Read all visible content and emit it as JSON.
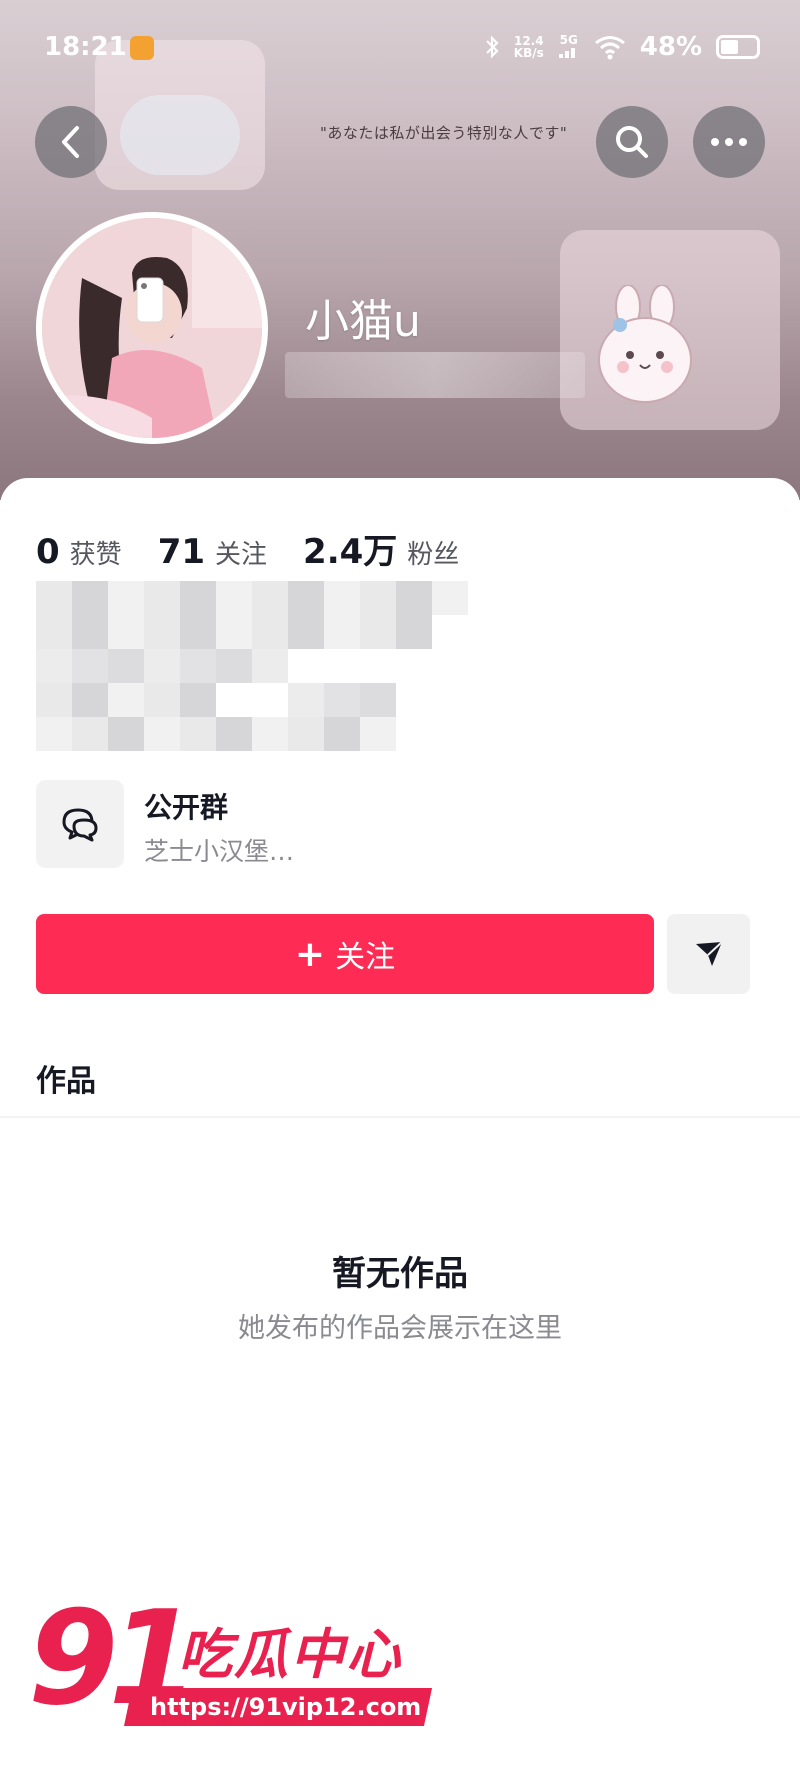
{
  "status_bar": {
    "time": "18:21",
    "net_speed_top": "12.4",
    "net_speed_bottom": "KB/s",
    "signal": "5G",
    "battery": "48%"
  },
  "header": {
    "quote": "\"あなたは私が出会う特別な人です\""
  },
  "profile": {
    "nickname": "小猫u"
  },
  "stats": [
    {
      "value": "0",
      "label": "获赞"
    },
    {
      "value": "71",
      "label": "关注"
    },
    {
      "value": "2.4万",
      "label": "粉丝"
    }
  ],
  "group": {
    "title": "公开群",
    "subtitle": "芝士小汉堡…"
  },
  "actions": {
    "follow_plus": "+",
    "follow_label": "关注"
  },
  "tabs": {
    "works": "作品"
  },
  "empty_state": {
    "title": "暂无作品",
    "subtitle": "她发布的作品会展示在这里"
  },
  "watermark": {
    "number": "91",
    "brand": "吃瓜中心",
    "url": "https://91vip12.com"
  },
  "colors": {
    "accent": "#fe2c55",
    "watermark": "#e8214f"
  }
}
